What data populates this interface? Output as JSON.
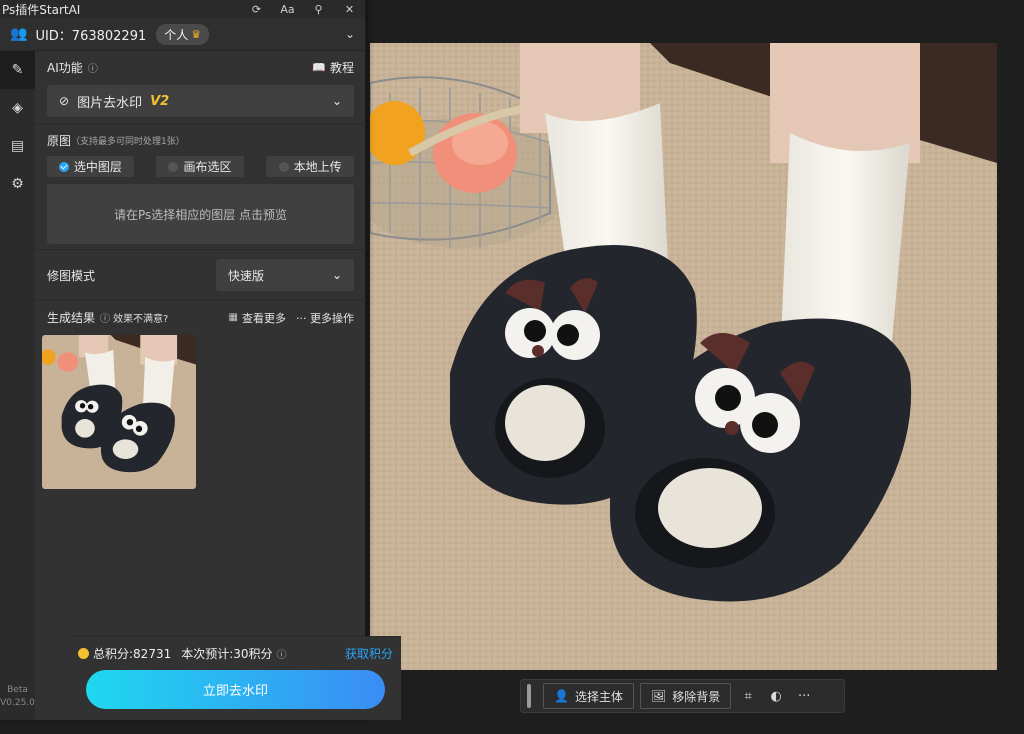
{
  "titlebar": {
    "title": "Ps插件StartAI"
  },
  "user": {
    "uid": "UID：763802291",
    "tier": "个人"
  },
  "ai_function": {
    "label": "AI功能",
    "tutorial": "教程",
    "selected": "图片去水印",
    "version": "V2"
  },
  "source": {
    "label": "原图",
    "hint": "（支持最多可同时处理1张）",
    "options": [
      "选中图层",
      "画布选区",
      "本地上传"
    ],
    "selected_index": 0,
    "placeholder": "请在Ps选择相应的图层 点击预览"
  },
  "mode": {
    "label": "修图模式",
    "value": "快速版"
  },
  "results": {
    "label": "生成结果",
    "feedback": "效果不满意?",
    "view_more": "查看更多",
    "more_ops": "··· 更多操作"
  },
  "footer": {
    "total_points": "总积分:82731",
    "estimate": "本次预计:30积分",
    "get_points": "获取积分",
    "go_button": "立即去水印"
  },
  "version": {
    "beta": "Beta",
    "number": "V0.25.0"
  },
  "canvas_toolbar": {
    "select_subject": "选择主体",
    "remove_bg": "移除背景"
  },
  "colors": {
    "accent": "#2aa4f4",
    "button_start": "#1fd8ef",
    "button_end": "#3a8cf5",
    "coin": "#f3c130",
    "crown": "#f0b429"
  }
}
